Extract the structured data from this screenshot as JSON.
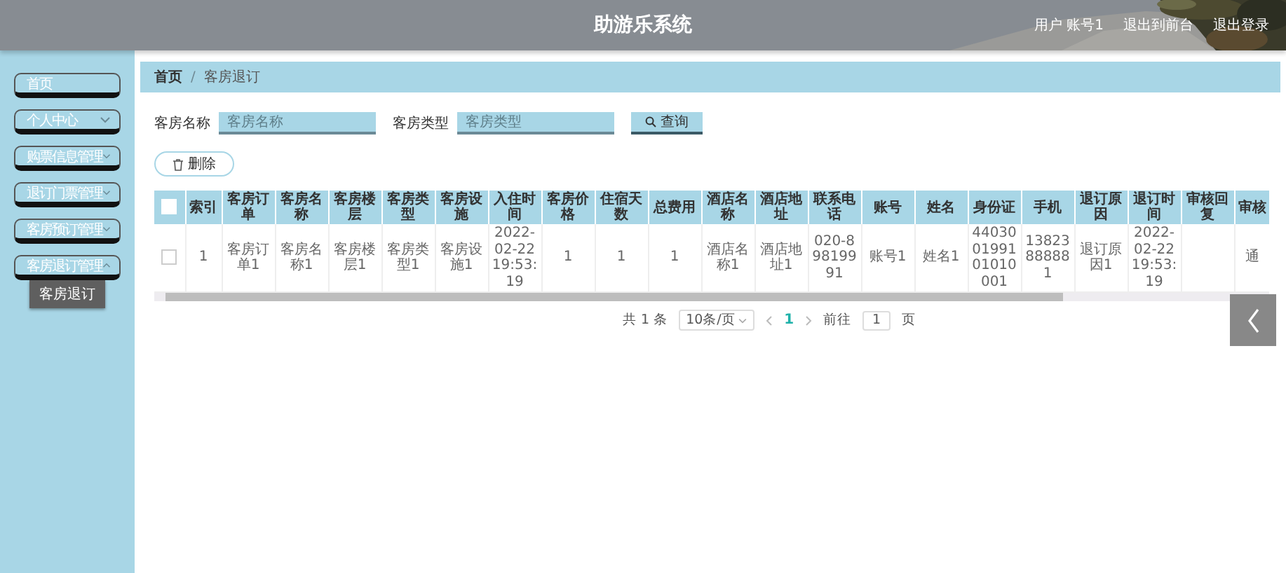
{
  "header": {
    "title": "助游乐系统",
    "user": "用户 账号1",
    "links": [
      "退出到前台",
      "退出登录"
    ]
  },
  "sidebar": {
    "items": [
      {
        "label": "首页",
        "kind": "link"
      },
      {
        "label": "个人中心",
        "kind": "submenu",
        "expanded": false
      },
      {
        "label": "购票信息管理",
        "kind": "submenu",
        "expanded": false
      },
      {
        "label": "退订门票管理",
        "kind": "submenu",
        "expanded": false
      },
      {
        "label": "客房预订管理",
        "kind": "submenu",
        "expanded": false
      },
      {
        "label": "客房退订管理",
        "kind": "submenu",
        "expanded": true,
        "children": [
          {
            "label": "客房退订",
            "selected": true
          }
        ]
      }
    ]
  },
  "breadcrumb": {
    "separator": "/",
    "items": [
      "首页",
      "客房退订"
    ]
  },
  "search": {
    "fields": [
      {
        "label": "客房名称",
        "placeholder": "客房名称"
      },
      {
        "label": "客房类型",
        "placeholder": "客房类型"
      }
    ],
    "button": "查询"
  },
  "actions": {
    "delete": "删除"
  },
  "table": {
    "all_checked": false,
    "columns": [
      "索引",
      "客房订单",
      "客房名称",
      "客房楼层",
      "客房类型",
      "客房设施",
      "入住时间",
      "客房价格",
      "住宿天数",
      "总费用",
      "酒店名称",
      "酒店地址",
      "联系电话",
      "账号",
      "姓名",
      "身份证",
      "手机",
      "退订原因",
      "退订时间",
      "审核回复",
      "审核"
    ],
    "rows": [
      {
        "checked": false,
        "cells": [
          "1",
          "客房订单1",
          "客房名称1",
          "客房楼层1",
          "客房类型1",
          "客房设施1",
          "2022-02-22 19:53:19",
          "1",
          "1",
          "1",
          "酒店名称1",
          "酒店地址1",
          "020-89819991",
          "账号1",
          "姓名1",
          "440300199101010001",
          "13823888881",
          "退订原因1",
          "2022-02-22 19:53:19",
          null,
          "通"
        ]
      }
    ]
  },
  "pagination": {
    "total": "共 1 条",
    "page_size": "10条/页",
    "pages": [
      {
        "label": "1",
        "selected": true
      }
    ],
    "goto_label": "前往",
    "goto_value": "1",
    "goto_suffix": "页"
  }
}
